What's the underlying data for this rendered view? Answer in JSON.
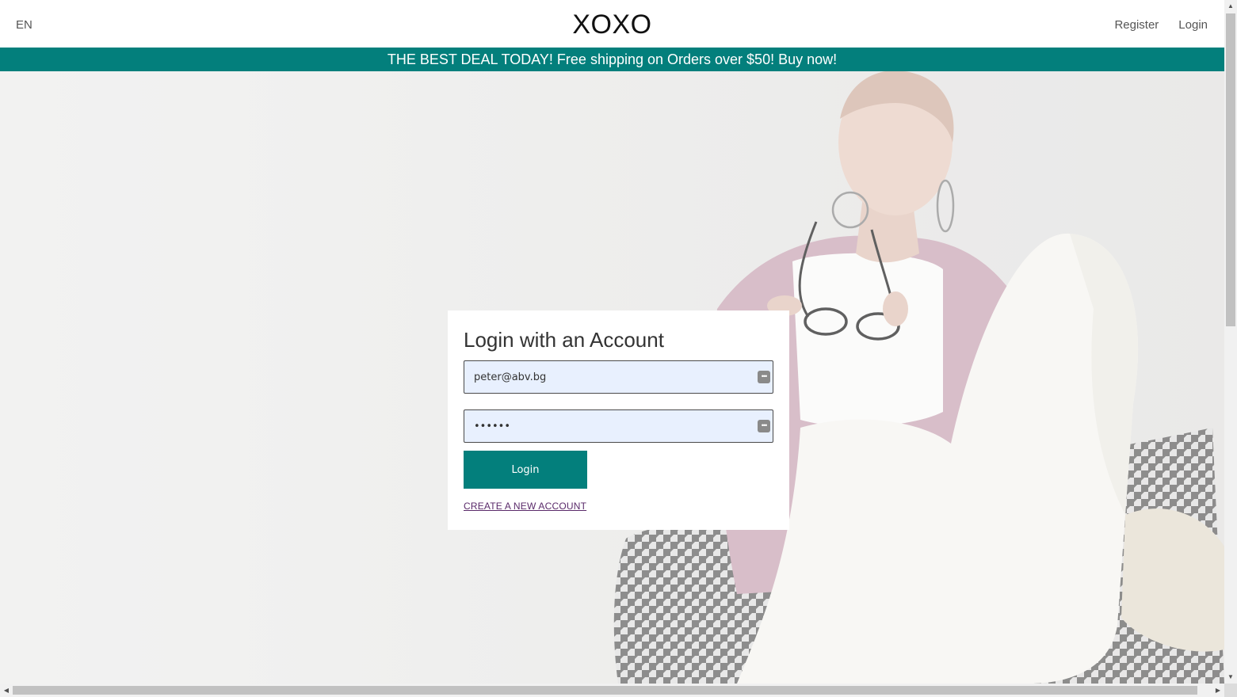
{
  "header": {
    "language": "EN",
    "logo": "XOXO",
    "register_label": "Register",
    "login_label": "Login"
  },
  "promo_banner": {
    "text": "THE BEST DEAL TODAY! Free shipping on Orders over $50! Buy now!"
  },
  "login_form": {
    "title": "Login with an Account",
    "email_value": "peter@abv.bg",
    "password_value": "••••••",
    "submit_label": "Login",
    "create_account_label": "CREATE A NEW ACCOUNT"
  },
  "icons": {
    "password_manager": "password-manager-icon"
  },
  "colors": {
    "accent": "#037f7c",
    "autofill_bg": "#e8f0fe",
    "link": "#5a2a6a"
  }
}
